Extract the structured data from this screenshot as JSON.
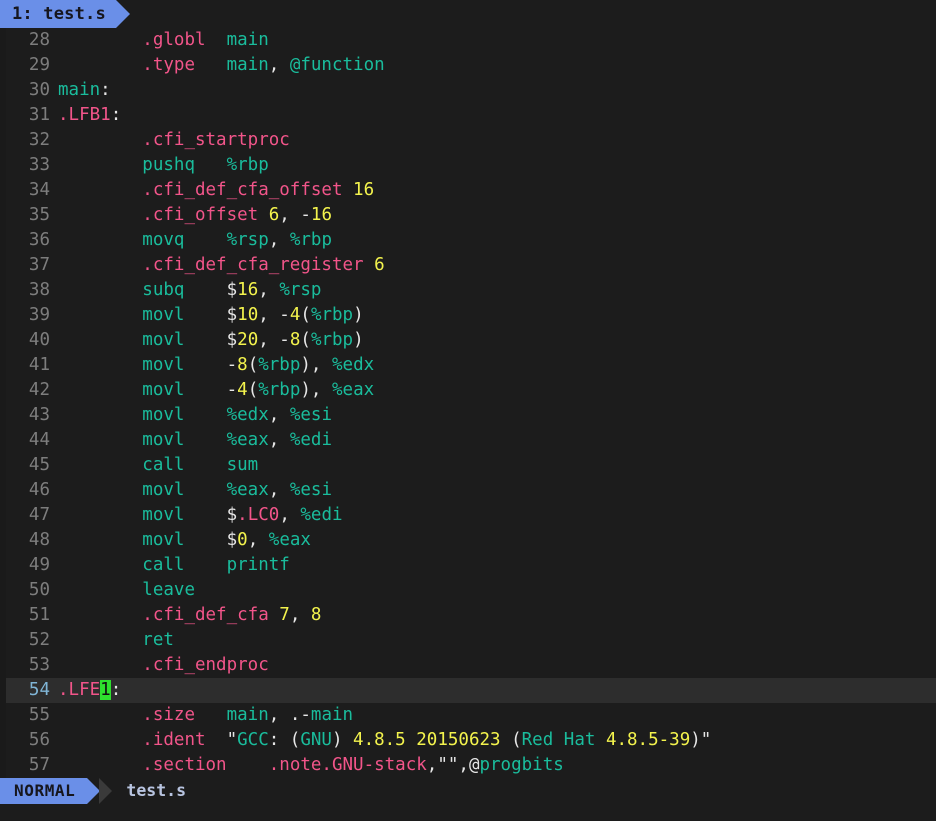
{
  "window": {
    "background": "#1c1c1c",
    "accent": "#6a8fe8",
    "cursor_color": "#2ee02e"
  },
  "tabline": {
    "tabs": [
      {
        "label": "1: test.s",
        "active": true
      }
    ]
  },
  "statusline": {
    "mode": "NORMAL",
    "filename": "test.s"
  },
  "editor": {
    "first_line": 28,
    "cursor_line": 54,
    "cursor_char": "1",
    "lines": [
      {
        "num": "28",
        "tokens": [
          {
            "t": "        ",
            "c": "c-pun"
          },
          {
            "t": ".globl",
            "c": "c-dir"
          },
          {
            "t": "  ",
            "c": "c-pun"
          },
          {
            "t": "main",
            "c": "c-id"
          }
        ]
      },
      {
        "num": "29",
        "tokens": [
          {
            "t": "        ",
            "c": "c-pun"
          },
          {
            "t": ".type",
            "c": "c-dir"
          },
          {
            "t": "   ",
            "c": "c-pun"
          },
          {
            "t": "main",
            "c": "c-id"
          },
          {
            "t": ", ",
            "c": "c-pun"
          },
          {
            "t": "@function",
            "c": "c-id"
          }
        ]
      },
      {
        "num": "30",
        "tokens": [
          {
            "t": "main",
            "c": "c-id"
          },
          {
            "t": ":",
            "c": "c-pun"
          }
        ]
      },
      {
        "num": "31",
        "tokens": [
          {
            "t": ".LFB1",
            "c": "c-dir"
          },
          {
            "t": ":",
            "c": "c-pun"
          }
        ]
      },
      {
        "num": "32",
        "tokens": [
          {
            "t": "        ",
            "c": "c-pun"
          },
          {
            "t": ".cfi_startproc",
            "c": "c-dir"
          }
        ]
      },
      {
        "num": "33",
        "tokens": [
          {
            "t": "        ",
            "c": "c-pun"
          },
          {
            "t": "pushq",
            "c": "c-id"
          },
          {
            "t": "   ",
            "c": "c-pun"
          },
          {
            "t": "%rbp",
            "c": "c-id"
          }
        ]
      },
      {
        "num": "34",
        "tokens": [
          {
            "t": "        ",
            "c": "c-pun"
          },
          {
            "t": ".cfi_def_cfa_offset",
            "c": "c-dir"
          },
          {
            "t": " ",
            "c": "c-pun"
          },
          {
            "t": "16",
            "c": "c-num"
          }
        ]
      },
      {
        "num": "35",
        "tokens": [
          {
            "t": "        ",
            "c": "c-pun"
          },
          {
            "t": ".cfi_offset",
            "c": "c-dir"
          },
          {
            "t": " ",
            "c": "c-pun"
          },
          {
            "t": "6",
            "c": "c-num"
          },
          {
            "t": ", -",
            "c": "c-pun"
          },
          {
            "t": "16",
            "c": "c-num"
          }
        ]
      },
      {
        "num": "36",
        "tokens": [
          {
            "t": "        ",
            "c": "c-pun"
          },
          {
            "t": "movq",
            "c": "c-id"
          },
          {
            "t": "    ",
            "c": "c-pun"
          },
          {
            "t": "%rsp",
            "c": "c-id"
          },
          {
            "t": ", ",
            "c": "c-pun"
          },
          {
            "t": "%rbp",
            "c": "c-id"
          }
        ]
      },
      {
        "num": "37",
        "tokens": [
          {
            "t": "        ",
            "c": "c-pun"
          },
          {
            "t": ".cfi_def_cfa_register",
            "c": "c-dir"
          },
          {
            "t": " ",
            "c": "c-pun"
          },
          {
            "t": "6",
            "c": "c-num"
          }
        ]
      },
      {
        "num": "38",
        "tokens": [
          {
            "t": "        ",
            "c": "c-pun"
          },
          {
            "t": "subq",
            "c": "c-id"
          },
          {
            "t": "    ",
            "c": "c-pun"
          },
          {
            "t": "$",
            "c": "c-pun"
          },
          {
            "t": "16",
            "c": "c-num"
          },
          {
            "t": ", ",
            "c": "c-pun"
          },
          {
            "t": "%rsp",
            "c": "c-id"
          }
        ]
      },
      {
        "num": "39",
        "tokens": [
          {
            "t": "        ",
            "c": "c-pun"
          },
          {
            "t": "movl",
            "c": "c-id"
          },
          {
            "t": "    ",
            "c": "c-pun"
          },
          {
            "t": "$",
            "c": "c-pun"
          },
          {
            "t": "10",
            "c": "c-num"
          },
          {
            "t": ", -",
            "c": "c-pun"
          },
          {
            "t": "4",
            "c": "c-num"
          },
          {
            "t": "(",
            "c": "c-pun"
          },
          {
            "t": "%rbp",
            "c": "c-id"
          },
          {
            "t": ")",
            "c": "c-pun"
          }
        ]
      },
      {
        "num": "40",
        "tokens": [
          {
            "t": "        ",
            "c": "c-pun"
          },
          {
            "t": "movl",
            "c": "c-id"
          },
          {
            "t": "    ",
            "c": "c-pun"
          },
          {
            "t": "$",
            "c": "c-pun"
          },
          {
            "t": "20",
            "c": "c-num"
          },
          {
            "t": ", -",
            "c": "c-pun"
          },
          {
            "t": "8",
            "c": "c-num"
          },
          {
            "t": "(",
            "c": "c-pun"
          },
          {
            "t": "%rbp",
            "c": "c-id"
          },
          {
            "t": ")",
            "c": "c-pun"
          }
        ]
      },
      {
        "num": "41",
        "tokens": [
          {
            "t": "        ",
            "c": "c-pun"
          },
          {
            "t": "movl",
            "c": "c-id"
          },
          {
            "t": "    -",
            "c": "c-pun"
          },
          {
            "t": "8",
            "c": "c-num"
          },
          {
            "t": "(",
            "c": "c-pun"
          },
          {
            "t": "%rbp",
            "c": "c-id"
          },
          {
            "t": "), ",
            "c": "c-pun"
          },
          {
            "t": "%edx",
            "c": "c-id"
          }
        ]
      },
      {
        "num": "42",
        "tokens": [
          {
            "t": "        ",
            "c": "c-pun"
          },
          {
            "t": "movl",
            "c": "c-id"
          },
          {
            "t": "    -",
            "c": "c-pun"
          },
          {
            "t": "4",
            "c": "c-num"
          },
          {
            "t": "(",
            "c": "c-pun"
          },
          {
            "t": "%rbp",
            "c": "c-id"
          },
          {
            "t": "), ",
            "c": "c-pun"
          },
          {
            "t": "%eax",
            "c": "c-id"
          }
        ]
      },
      {
        "num": "43",
        "tokens": [
          {
            "t": "        ",
            "c": "c-pun"
          },
          {
            "t": "movl",
            "c": "c-id"
          },
          {
            "t": "    ",
            "c": "c-pun"
          },
          {
            "t": "%edx",
            "c": "c-id"
          },
          {
            "t": ", ",
            "c": "c-pun"
          },
          {
            "t": "%esi",
            "c": "c-id"
          }
        ]
      },
      {
        "num": "44",
        "tokens": [
          {
            "t": "        ",
            "c": "c-pun"
          },
          {
            "t": "movl",
            "c": "c-id"
          },
          {
            "t": "    ",
            "c": "c-pun"
          },
          {
            "t": "%eax",
            "c": "c-id"
          },
          {
            "t": ", ",
            "c": "c-pun"
          },
          {
            "t": "%edi",
            "c": "c-id"
          }
        ]
      },
      {
        "num": "45",
        "tokens": [
          {
            "t": "        ",
            "c": "c-pun"
          },
          {
            "t": "call",
            "c": "c-id"
          },
          {
            "t": "    ",
            "c": "c-pun"
          },
          {
            "t": "sum",
            "c": "c-id"
          }
        ]
      },
      {
        "num": "46",
        "tokens": [
          {
            "t": "        ",
            "c": "c-pun"
          },
          {
            "t": "movl",
            "c": "c-id"
          },
          {
            "t": "    ",
            "c": "c-pun"
          },
          {
            "t": "%eax",
            "c": "c-id"
          },
          {
            "t": ", ",
            "c": "c-pun"
          },
          {
            "t": "%esi",
            "c": "c-id"
          }
        ]
      },
      {
        "num": "47",
        "tokens": [
          {
            "t": "        ",
            "c": "c-pun"
          },
          {
            "t": "movl",
            "c": "c-id"
          },
          {
            "t": "    ",
            "c": "c-pun"
          },
          {
            "t": "$",
            "c": "c-pun"
          },
          {
            "t": ".LC0",
            "c": "c-dir"
          },
          {
            "t": ", ",
            "c": "c-pun"
          },
          {
            "t": "%edi",
            "c": "c-id"
          }
        ]
      },
      {
        "num": "48",
        "tokens": [
          {
            "t": "        ",
            "c": "c-pun"
          },
          {
            "t": "movl",
            "c": "c-id"
          },
          {
            "t": "    ",
            "c": "c-pun"
          },
          {
            "t": "$",
            "c": "c-pun"
          },
          {
            "t": "0",
            "c": "c-num"
          },
          {
            "t": ", ",
            "c": "c-pun"
          },
          {
            "t": "%eax",
            "c": "c-id"
          }
        ]
      },
      {
        "num": "49",
        "tokens": [
          {
            "t": "        ",
            "c": "c-pun"
          },
          {
            "t": "call",
            "c": "c-id"
          },
          {
            "t": "    ",
            "c": "c-pun"
          },
          {
            "t": "printf",
            "c": "c-id"
          }
        ]
      },
      {
        "num": "50",
        "tokens": [
          {
            "t": "        ",
            "c": "c-pun"
          },
          {
            "t": "leave",
            "c": "c-id"
          }
        ]
      },
      {
        "num": "51",
        "tokens": [
          {
            "t": "        ",
            "c": "c-pun"
          },
          {
            "t": ".cfi_def_cfa",
            "c": "c-dir"
          },
          {
            "t": " ",
            "c": "c-pun"
          },
          {
            "t": "7",
            "c": "c-num"
          },
          {
            "t": ", ",
            "c": "c-pun"
          },
          {
            "t": "8",
            "c": "c-num"
          }
        ]
      },
      {
        "num": "52",
        "tokens": [
          {
            "t": "        ",
            "c": "c-pun"
          },
          {
            "t": "ret",
            "c": "c-id"
          }
        ]
      },
      {
        "num": "53",
        "tokens": [
          {
            "t": "        ",
            "c": "c-pun"
          },
          {
            "t": ".cfi_endproc",
            "c": "c-dir"
          }
        ]
      },
      {
        "num": "54",
        "cursorline": true,
        "tokens": [
          {
            "t": ".LFE",
            "c": "c-dir"
          },
          {
            "t": "1",
            "c": "c-dir",
            "cursor": true
          },
          {
            "t": ":",
            "c": "c-pun"
          }
        ]
      },
      {
        "num": "55",
        "tokens": [
          {
            "t": "        ",
            "c": "c-pun"
          },
          {
            "t": ".size",
            "c": "c-dir"
          },
          {
            "t": "   ",
            "c": "c-pun"
          },
          {
            "t": "main",
            "c": "c-id"
          },
          {
            "t": ", ",
            "c": "c-pun"
          },
          {
            "t": ".-",
            "c": "c-pun"
          },
          {
            "t": "main",
            "c": "c-id"
          }
        ]
      },
      {
        "num": "56",
        "tokens": [
          {
            "t": "        ",
            "c": "c-pun"
          },
          {
            "t": ".ident",
            "c": "c-dir"
          },
          {
            "t": "  \"",
            "c": "c-pun"
          },
          {
            "t": "GCC",
            "c": "c-id"
          },
          {
            "t": ": (",
            "c": "c-pun"
          },
          {
            "t": "GNU",
            "c": "c-id"
          },
          {
            "t": ") ",
            "c": "c-pun"
          },
          {
            "t": "4.8.5",
            "c": "c-num"
          },
          {
            "t": " ",
            "c": "c-pun"
          },
          {
            "t": "20150623",
            "c": "c-num"
          },
          {
            "t": " (",
            "c": "c-pun"
          },
          {
            "t": "Red",
            "c": "c-id"
          },
          {
            "t": " ",
            "c": "c-pun"
          },
          {
            "t": "Hat",
            "c": "c-id"
          },
          {
            "t": " ",
            "c": "c-pun"
          },
          {
            "t": "4.8.5-39",
            "c": "c-num"
          },
          {
            "t": ")\"",
            "c": "c-pun"
          }
        ]
      },
      {
        "num": "57",
        "tokens": [
          {
            "t": "        ",
            "c": "c-pun"
          },
          {
            "t": ".section",
            "c": "c-dir"
          },
          {
            "t": "    ",
            "c": "c-pun"
          },
          {
            "t": ".note.GNU-stack",
            "c": "c-dir"
          },
          {
            "t": ",\"\",@",
            "c": "c-pun"
          },
          {
            "t": "progbits",
            "c": "c-id"
          }
        ]
      }
    ]
  }
}
